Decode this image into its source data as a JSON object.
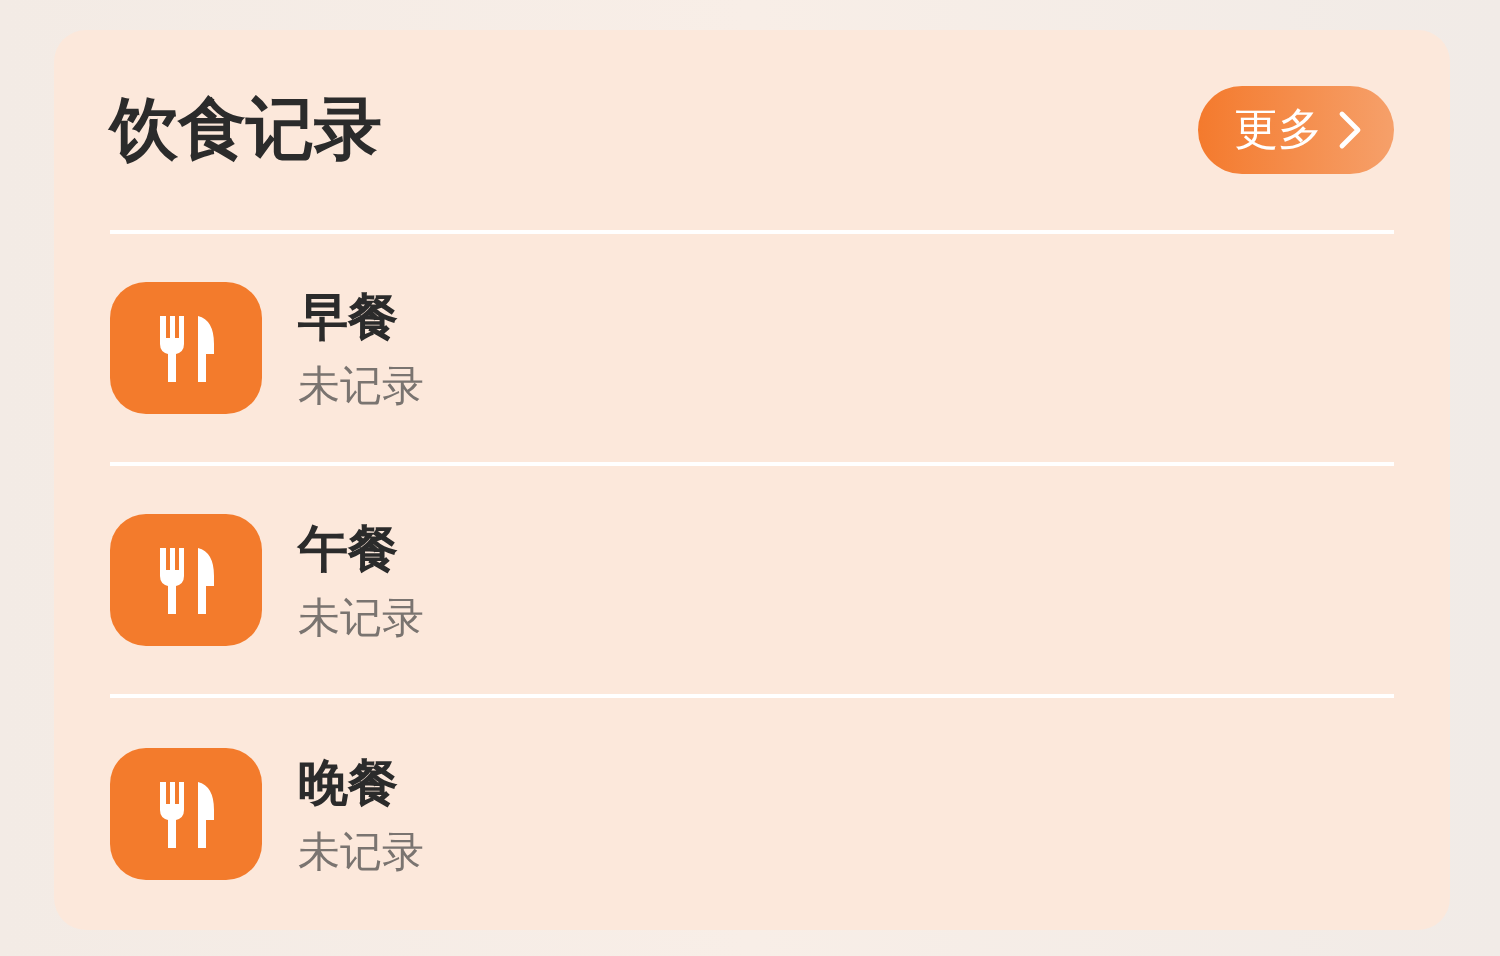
{
  "title": "饮食记录",
  "more_button": {
    "label": "更多"
  },
  "meals": [
    {
      "name": "早餐",
      "status": "未记录"
    },
    {
      "name": "午餐",
      "status": "未记录"
    },
    {
      "name": "晚餐",
      "status": "未记录"
    }
  ]
}
